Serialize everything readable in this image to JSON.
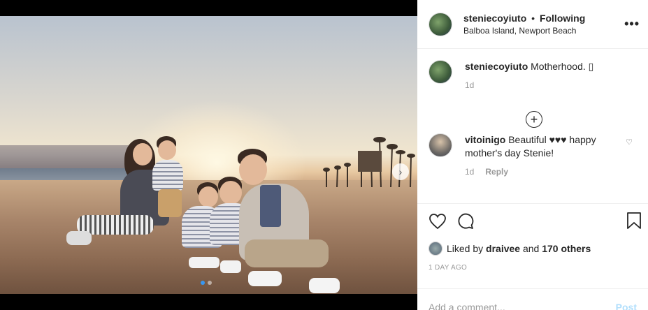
{
  "post": {
    "username": "steniecoyiuto",
    "separator": "•",
    "follow_status": "Following",
    "location": "Balboa Island, Newport Beach",
    "more_icon": "ellipsis-icon"
  },
  "caption": {
    "username": "steniecoyiuto",
    "text": "Motherhood. ",
    "emoji": "▯",
    "time": "1d"
  },
  "load_more_icon": "plus-circle-icon",
  "comments": [
    {
      "username": "vitoinigo",
      "text": "Beautiful ♥♥♥ happy mother's day Stenie!",
      "time": "1d",
      "reply_label": "Reply"
    }
  ],
  "likes": {
    "prefix": "Liked by",
    "user": "draivee",
    "suffix": "and",
    "count_text": "170 others"
  },
  "date": "1 DAY AGO",
  "add_comment": {
    "placeholder": "Add a comment...",
    "post_label": "Post"
  },
  "carousel": {
    "current": 1,
    "total": 2
  },
  "colors": {
    "accent": "#3897f0",
    "post_disabled": "#b2dffc",
    "muted": "#999999",
    "text": "#262626"
  }
}
